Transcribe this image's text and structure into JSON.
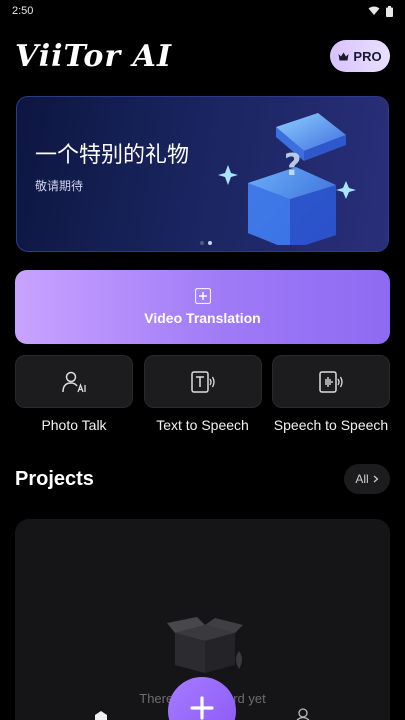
{
  "status_bar": {
    "time": "2:50"
  },
  "header": {
    "logo": "ViiTor AI",
    "pro_label": "PRO"
  },
  "banner": {
    "title": "一个特别的礼物",
    "subtitle": "敬请期待",
    "slides": 2,
    "active_slide": 1
  },
  "video_translation": {
    "label": "Video Translation",
    "icon": "plus-square-icon"
  },
  "tools": [
    {
      "label": "Photo Talk",
      "icon": "person-ai-icon"
    },
    {
      "label": "Text to Speech",
      "icon": "text-speech-icon"
    },
    {
      "label": "Speech to Speech",
      "icon": "speech-speech-icon"
    }
  ],
  "projects": {
    "title": "Projects",
    "all_label": "All",
    "empty_text": "There is no record yet"
  },
  "colors": {
    "accent_start": "#c9a3ff",
    "accent_end": "#8d6af2",
    "background": "#000000",
    "card": "#1c1c1e"
  }
}
